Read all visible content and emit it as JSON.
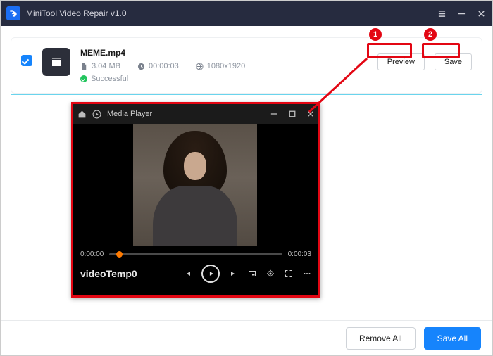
{
  "app": {
    "title": "MiniTool Video Repair v1.0"
  },
  "file": {
    "name": "MEME.mp4",
    "size": "3.04 MB",
    "duration": "00:00:03",
    "resolution": "1080x1920",
    "status": "Successful"
  },
  "actions": {
    "preview": "Preview",
    "save": "Save"
  },
  "player": {
    "title": "Media Player",
    "pos": "0:00:00",
    "len": "0:00:03",
    "temp_name": "videoTemp0"
  },
  "footer": {
    "remove_all": "Remove All",
    "save_all": "Save All"
  },
  "annotations": {
    "badge1": "1",
    "badge2": "2"
  }
}
